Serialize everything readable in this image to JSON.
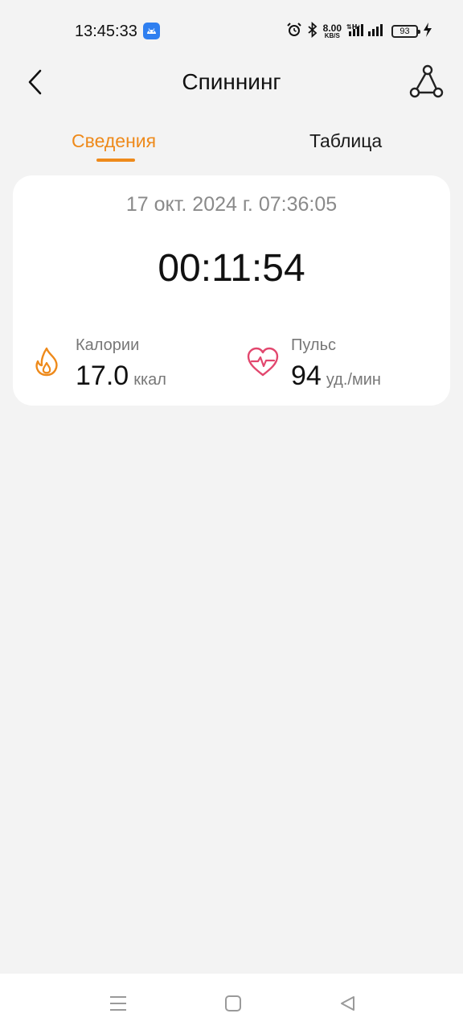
{
  "status_bar": {
    "time": "13:45:33",
    "net_speed": "8.00",
    "net_speed_unit": "KB/S",
    "network_type": "H+",
    "battery": "93",
    "icons": [
      "android-app-icon",
      "alarm-icon",
      "bluetooth-icon",
      "signal-icon",
      "battery-icon",
      "charging-icon"
    ]
  },
  "header": {
    "title": "Спиннинг",
    "back_icon": "back-arrow-icon",
    "route_icon": "route-share-icon"
  },
  "tabs": [
    {
      "label": "Сведения",
      "active": true
    },
    {
      "label": "Таблица",
      "active": false
    }
  ],
  "summary": {
    "date": "17 окт. 2024 г. 07:36:05",
    "duration": "00:11:54",
    "calories": {
      "label": "Калории",
      "value": "17.0",
      "unit": "ккал"
    },
    "pulse": {
      "label": "Пульс",
      "value": "94",
      "unit": "уд./мин"
    }
  },
  "colors": {
    "accent": "#ee8a1b",
    "heart": "#e2476e",
    "background": "#f3f3f3",
    "card": "#ffffff"
  },
  "nav": {
    "icons": [
      "menu-icon",
      "home-square-icon",
      "back-triangle-icon"
    ]
  }
}
